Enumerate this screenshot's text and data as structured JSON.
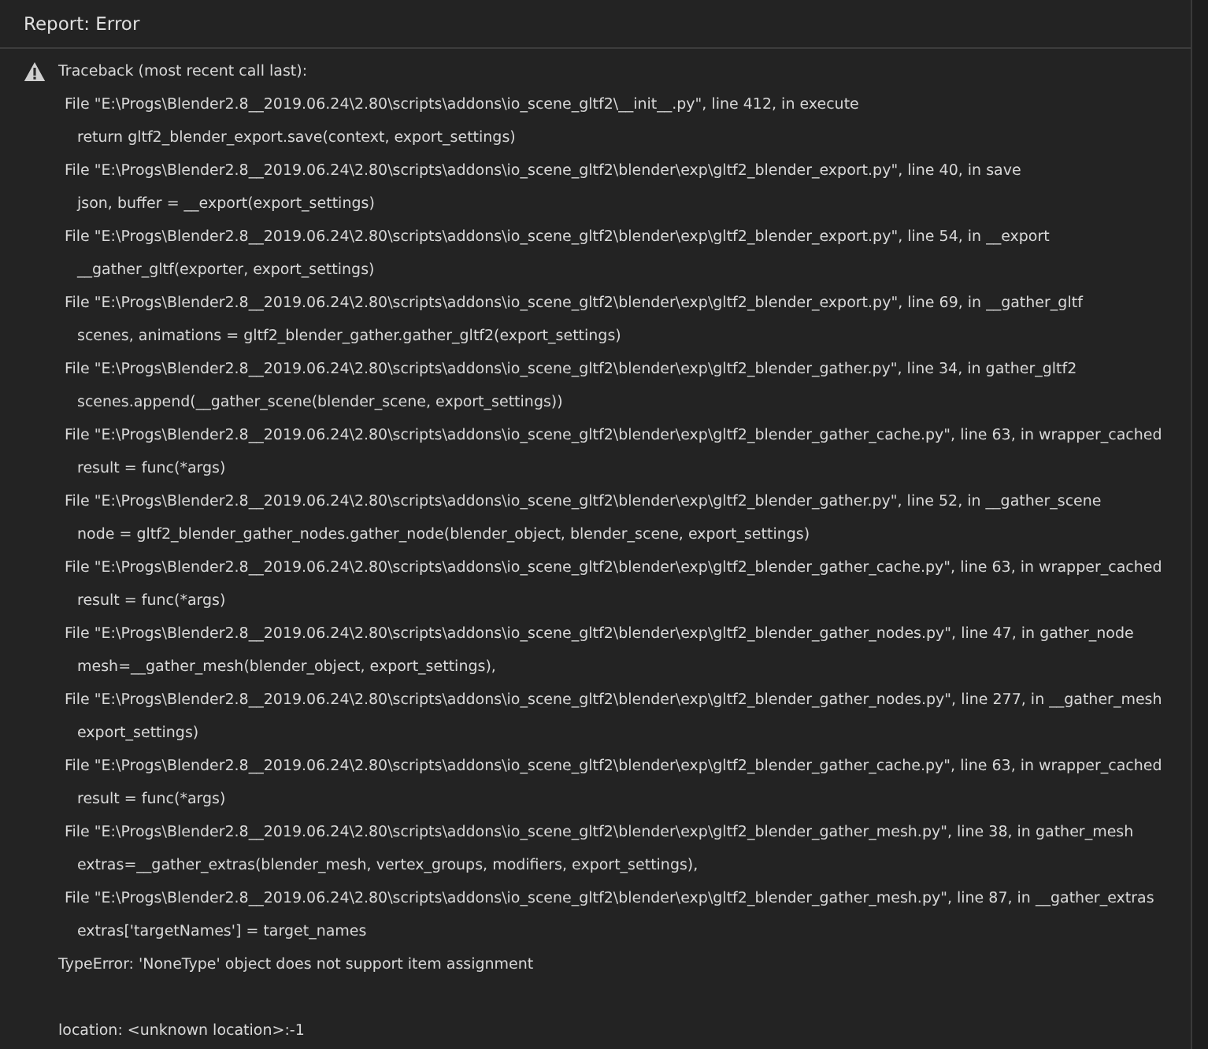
{
  "window": {
    "title": "Report: Error"
  },
  "report": {
    "heading": "Traceback (most recent call last):",
    "frames": [
      {
        "file": "File \"E:\\Progs\\Blender2.8__2019.06.24\\2.80\\scripts\\addons\\io_scene_gltf2\\__init__.py\", line 412, in execute",
        "code": "return gltf2_blender_export.save(context, export_settings)"
      },
      {
        "file": "File \"E:\\Progs\\Blender2.8__2019.06.24\\2.80\\scripts\\addons\\io_scene_gltf2\\blender\\exp\\gltf2_blender_export.py\", line 40, in save",
        "code": "json, buffer = __export(export_settings)"
      },
      {
        "file": "File \"E:\\Progs\\Blender2.8__2019.06.24\\2.80\\scripts\\addons\\io_scene_gltf2\\blender\\exp\\gltf2_blender_export.py\", line 54, in __export",
        "code": "__gather_gltf(exporter, export_settings)"
      },
      {
        "file": "File \"E:\\Progs\\Blender2.8__2019.06.24\\2.80\\scripts\\addons\\io_scene_gltf2\\blender\\exp\\gltf2_blender_export.py\", line 69, in __gather_gltf",
        "code": "scenes, animations = gltf2_blender_gather.gather_gltf2(export_settings)"
      },
      {
        "file": "File \"E:\\Progs\\Blender2.8__2019.06.24\\2.80\\scripts\\addons\\io_scene_gltf2\\blender\\exp\\gltf2_blender_gather.py\", line 34, in gather_gltf2",
        "code": "scenes.append(__gather_scene(blender_scene, export_settings))"
      },
      {
        "file": "File \"E:\\Progs\\Blender2.8__2019.06.24\\2.80\\scripts\\addons\\io_scene_gltf2\\blender\\exp\\gltf2_blender_gather_cache.py\", line 63, in wrapper_cached",
        "code": "result = func(*args)"
      },
      {
        "file": "File \"E:\\Progs\\Blender2.8__2019.06.24\\2.80\\scripts\\addons\\io_scene_gltf2\\blender\\exp\\gltf2_blender_gather.py\", line 52, in __gather_scene",
        "code": "node = gltf2_blender_gather_nodes.gather_node(blender_object, blender_scene, export_settings)"
      },
      {
        "file": "File \"E:\\Progs\\Blender2.8__2019.06.24\\2.80\\scripts\\addons\\io_scene_gltf2\\blender\\exp\\gltf2_blender_gather_cache.py\", line 63, in wrapper_cached",
        "code": "result = func(*args)"
      },
      {
        "file": "File \"E:\\Progs\\Blender2.8__2019.06.24\\2.80\\scripts\\addons\\io_scene_gltf2\\blender\\exp\\gltf2_blender_gather_nodes.py\", line 47, in gather_node",
        "code": "mesh=__gather_mesh(blender_object, export_settings),"
      },
      {
        "file": "File \"E:\\Progs\\Blender2.8__2019.06.24\\2.80\\scripts\\addons\\io_scene_gltf2\\blender\\exp\\gltf2_blender_gather_nodes.py\", line 277, in __gather_mesh",
        "code": "export_settings)"
      },
      {
        "file": "File \"E:\\Progs\\Blender2.8__2019.06.24\\2.80\\scripts\\addons\\io_scene_gltf2\\blender\\exp\\gltf2_blender_gather_cache.py\", line 63, in wrapper_cached",
        "code": "result = func(*args)"
      },
      {
        "file": "File \"E:\\Progs\\Blender2.8__2019.06.24\\2.80\\scripts\\addons\\io_scene_gltf2\\blender\\exp\\gltf2_blender_gather_mesh.py\", line 38, in gather_mesh",
        "code": "extras=__gather_extras(blender_mesh, vertex_groups, modifiers, export_settings),"
      },
      {
        "file": "File \"E:\\Progs\\Blender2.8__2019.06.24\\2.80\\scripts\\addons\\io_scene_gltf2\\blender\\exp\\gltf2_blender_gather_mesh.py\", line 87, in __gather_extras",
        "code": "extras['targetNames'] = target_names"
      }
    ],
    "error": "TypeError: 'NoneType' object does not support item assignment",
    "location": "location: <unknown location>:-1"
  }
}
